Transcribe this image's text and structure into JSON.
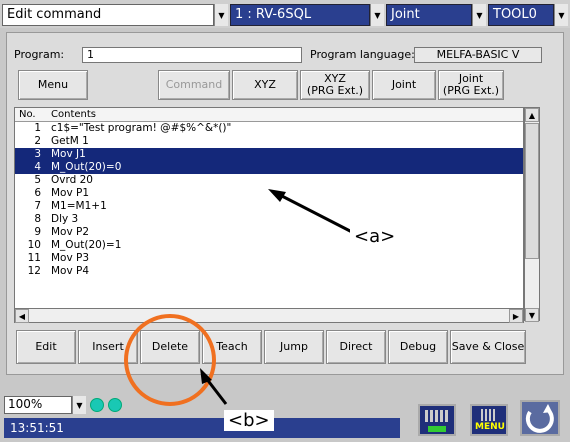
{
  "topbar": {
    "mode": "Edit command",
    "robot": "1 : RV-6SQL",
    "jog_mode": "Joint",
    "tool": "TOOL0"
  },
  "program": {
    "label": "Program:",
    "value": "1",
    "language_label": "Program language:",
    "language_value": "MELFA-BASIC V"
  },
  "toolbar": {
    "menu": "Menu",
    "command": "Command",
    "xyz": "XYZ",
    "xyz_prg": "XYZ\n(PRG Ext.)",
    "joint": "Joint",
    "joint_prg": "Joint\n(PRG Ext.)"
  },
  "list": {
    "col_no": "No.",
    "col_contents": "Contents",
    "rows": [
      {
        "no": "1",
        "text": "c1$=\"Test program! @#$%^&*()\""
      },
      {
        "no": "2",
        "text": "GetM 1"
      },
      {
        "no": "3",
        "text": "Mov J1"
      },
      {
        "no": "4",
        "text": "M_Out(20)=0"
      },
      {
        "no": "5",
        "text": "Ovrd 20"
      },
      {
        "no": "6",
        "text": "Mov P1"
      },
      {
        "no": "7",
        "text": "M1=M1+1"
      },
      {
        "no": "8",
        "text": "Dly 3"
      },
      {
        "no": "9",
        "text": "Mov P2"
      },
      {
        "no": "10",
        "text": "M_Out(20)=1"
      },
      {
        "no": "11",
        "text": "Mov P3"
      },
      {
        "no": "12",
        "text": "Mov P4"
      }
    ]
  },
  "actions": {
    "edit": "Edit",
    "insert": "Insert",
    "delete": "Delete",
    "teach": "Teach",
    "jump": "Jump",
    "direct": "Direct",
    "debug": "Debug",
    "save_close": "Save & Close"
  },
  "status": {
    "zoom": "100%",
    "time": "13:51:51",
    "menu_icon_label": "MENU"
  },
  "annotations": {
    "a": "<a>",
    "b": "<b>"
  },
  "colors": {
    "selection": "#14287a",
    "status_bar": "#2a3f8f",
    "indicator": "#19c8b4",
    "highlight_circle": "#f07020"
  }
}
